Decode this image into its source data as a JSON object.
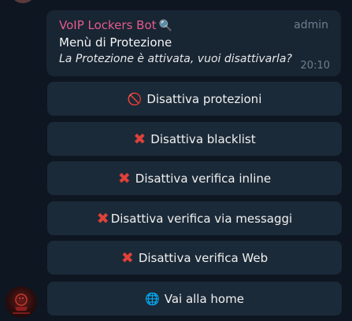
{
  "message": {
    "sender": "VoIP Lockers Bot",
    "sender_icon": "magnifier-icon",
    "role": "admin",
    "title": "Menù di Protezione",
    "body": "La Protezione è attivata, vuoi disattivarla?",
    "time": "20:10"
  },
  "keyboard": {
    "buttons": [
      {
        "icon": "prohibited-icon",
        "glyph": "🚫",
        "label": "Disattiva protezioni"
      },
      {
        "icon": "cross-icon",
        "glyph": "✖",
        "label": "Disattiva blacklist"
      },
      {
        "icon": "cross-icon",
        "glyph": "✖",
        "label": "Disattiva verifica inline"
      },
      {
        "icon": "cross-icon",
        "glyph": "✖",
        "label": "Disattiva verifica via messaggi"
      },
      {
        "icon": "cross-icon",
        "glyph": "✖",
        "label": "Disattiva verifica Web"
      },
      {
        "icon": "globe-icon",
        "glyph": "🌐",
        "label": "Vai alla home"
      }
    ]
  },
  "colors": {
    "background": "#0e1621",
    "bubble": "#182533",
    "button": "#1b2a38",
    "sender": "#e55b8c",
    "muted": "#6d7f8f"
  }
}
